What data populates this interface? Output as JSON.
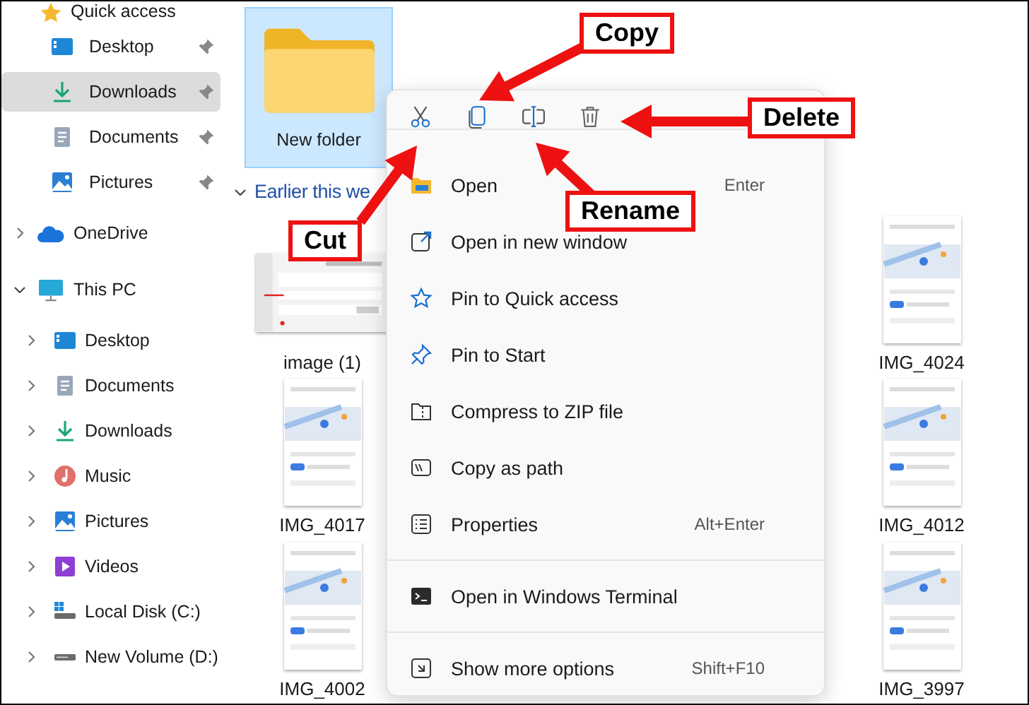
{
  "sidebar": {
    "quick_access": {
      "label": "Quick access",
      "items": [
        {
          "label": "Desktop",
          "kind": "desktop",
          "pinned": true,
          "selected": false
        },
        {
          "label": "Downloads",
          "kind": "downloads",
          "pinned": true,
          "selected": true
        },
        {
          "label": "Documents",
          "kind": "documents",
          "pinned": true,
          "selected": false
        },
        {
          "label": "Pictures",
          "kind": "pictures",
          "pinned": true,
          "selected": false
        }
      ]
    },
    "tree": [
      {
        "label": "OneDrive",
        "kind": "onedrive",
        "expanded": false
      },
      {
        "label": "This PC",
        "kind": "pc",
        "expanded": true,
        "children": [
          {
            "label": "Desktop",
            "kind": "desktop",
            "expanded": false
          },
          {
            "label": "Documents",
            "kind": "documents",
            "expanded": false
          },
          {
            "label": "Downloads",
            "kind": "downloads",
            "expanded": false
          },
          {
            "label": "Music",
            "kind": "music",
            "expanded": false
          },
          {
            "label": "Pictures",
            "kind": "pictures",
            "expanded": false
          },
          {
            "label": "Videos",
            "kind": "videos",
            "expanded": false
          },
          {
            "label": "Local Disk (C:)",
            "kind": "systemdisk",
            "expanded": false
          },
          {
            "label": "New Volume (D:)",
            "kind": "disk",
            "expanded": false
          }
        ]
      }
    ]
  },
  "content": {
    "folder": {
      "label": "New folder",
      "selected": true
    },
    "group": {
      "label": "Earlier this we",
      "expanded": true
    },
    "rows": [
      {
        "items": [
          {
            "label": "image (1)",
            "kind": "landscape",
            "selected": false
          },
          {
            "label": "IMG_4024",
            "kind": "portrait",
            "selected": false
          }
        ]
      },
      {
        "items": [
          {
            "label": "IMG_4017",
            "kind": "portrait",
            "selected": false
          },
          {
            "label": "IMG_4012",
            "kind": "portrait",
            "selected": false
          }
        ]
      },
      {
        "items": [
          {
            "label": "IMG_4002",
            "kind": "portrait",
            "selected": false
          },
          {
            "label": "IMG_3997",
            "kind": "portrait",
            "selected": false
          }
        ]
      }
    ]
  },
  "context_menu": {
    "toolbar": [
      {
        "kind": "cut"
      },
      {
        "kind": "copy"
      },
      {
        "kind": "rename"
      },
      {
        "kind": "delete"
      }
    ],
    "sections": [
      [
        {
          "label": "Open",
          "kind": "open",
          "shortcut": "Enter"
        },
        {
          "label": "Open in new window",
          "kind": "newwindow"
        },
        {
          "label": "Pin to Quick access",
          "kind": "star"
        },
        {
          "label": "Pin to Start",
          "kind": "pin"
        },
        {
          "label": "Compress to ZIP file",
          "kind": "zip"
        },
        {
          "label": "Copy as path",
          "kind": "path"
        },
        {
          "label": "Properties",
          "kind": "properties",
          "shortcut": "Alt+Enter"
        }
      ],
      [
        {
          "label": "Open in Windows Terminal",
          "kind": "terminal"
        }
      ],
      [
        {
          "label": "Show more options",
          "kind": "more",
          "shortcut": "Shift+F10"
        }
      ]
    ]
  },
  "annotations": [
    {
      "label": "Copy",
      "kind": "copy"
    },
    {
      "label": "Delete",
      "kind": "delete"
    },
    {
      "label": "Rename",
      "kind": "rename"
    },
    {
      "label": "Cut",
      "kind": "cut"
    }
  ]
}
